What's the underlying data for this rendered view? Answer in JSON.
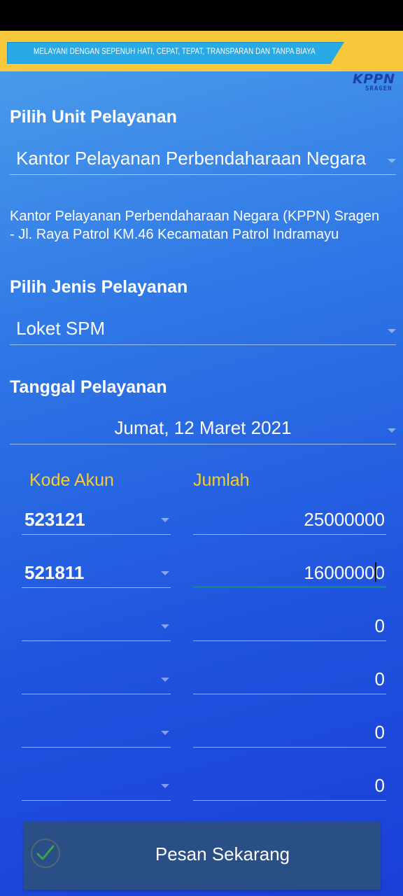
{
  "banner": {
    "tagline": "MELAYANI DENGAN SEPENUH HATI, CEPAT, TEPAT, TRANSPARAN DAN TANPA BIAYA",
    "logo_main": "KPPN",
    "logo_sub": "SRAGEN"
  },
  "unit": {
    "label": "Pilih Unit Pelayanan",
    "selected": "Kantor Pelayanan Perbendaharaan Negara",
    "address": "Kantor Pelayanan Perbendaharaan Negara (KPPN) Sragen - Jl. Raya Patrol KM.46 Kecamatan Patrol Indramayu"
  },
  "service": {
    "label": "Pilih Jenis Pelayanan",
    "selected": "Loket SPM"
  },
  "date": {
    "label": "Tanggal Pelayanan",
    "selected": "Jumat, 12 Maret 2021"
  },
  "accounts": {
    "col_code": "Kode Akun",
    "col_amount": "Jumlah",
    "rows": [
      {
        "code": "523121",
        "amount": "25000000"
      },
      {
        "code": "521811",
        "amount": "16000000"
      },
      {
        "code": "",
        "amount": "0"
      },
      {
        "code": "",
        "amount": "0"
      },
      {
        "code": "",
        "amount": "0"
      },
      {
        "code": "",
        "amount": "0"
      }
    ]
  },
  "order_button": {
    "label": "Pesan Sekarang"
  },
  "colors": {
    "accent": "#f7cc2c",
    "banner": "#f7c93a",
    "button": "#2a4f86",
    "check": "#3dbb3d"
  },
  "icons": [
    "dropdown-caret-icon",
    "check-icon"
  ]
}
